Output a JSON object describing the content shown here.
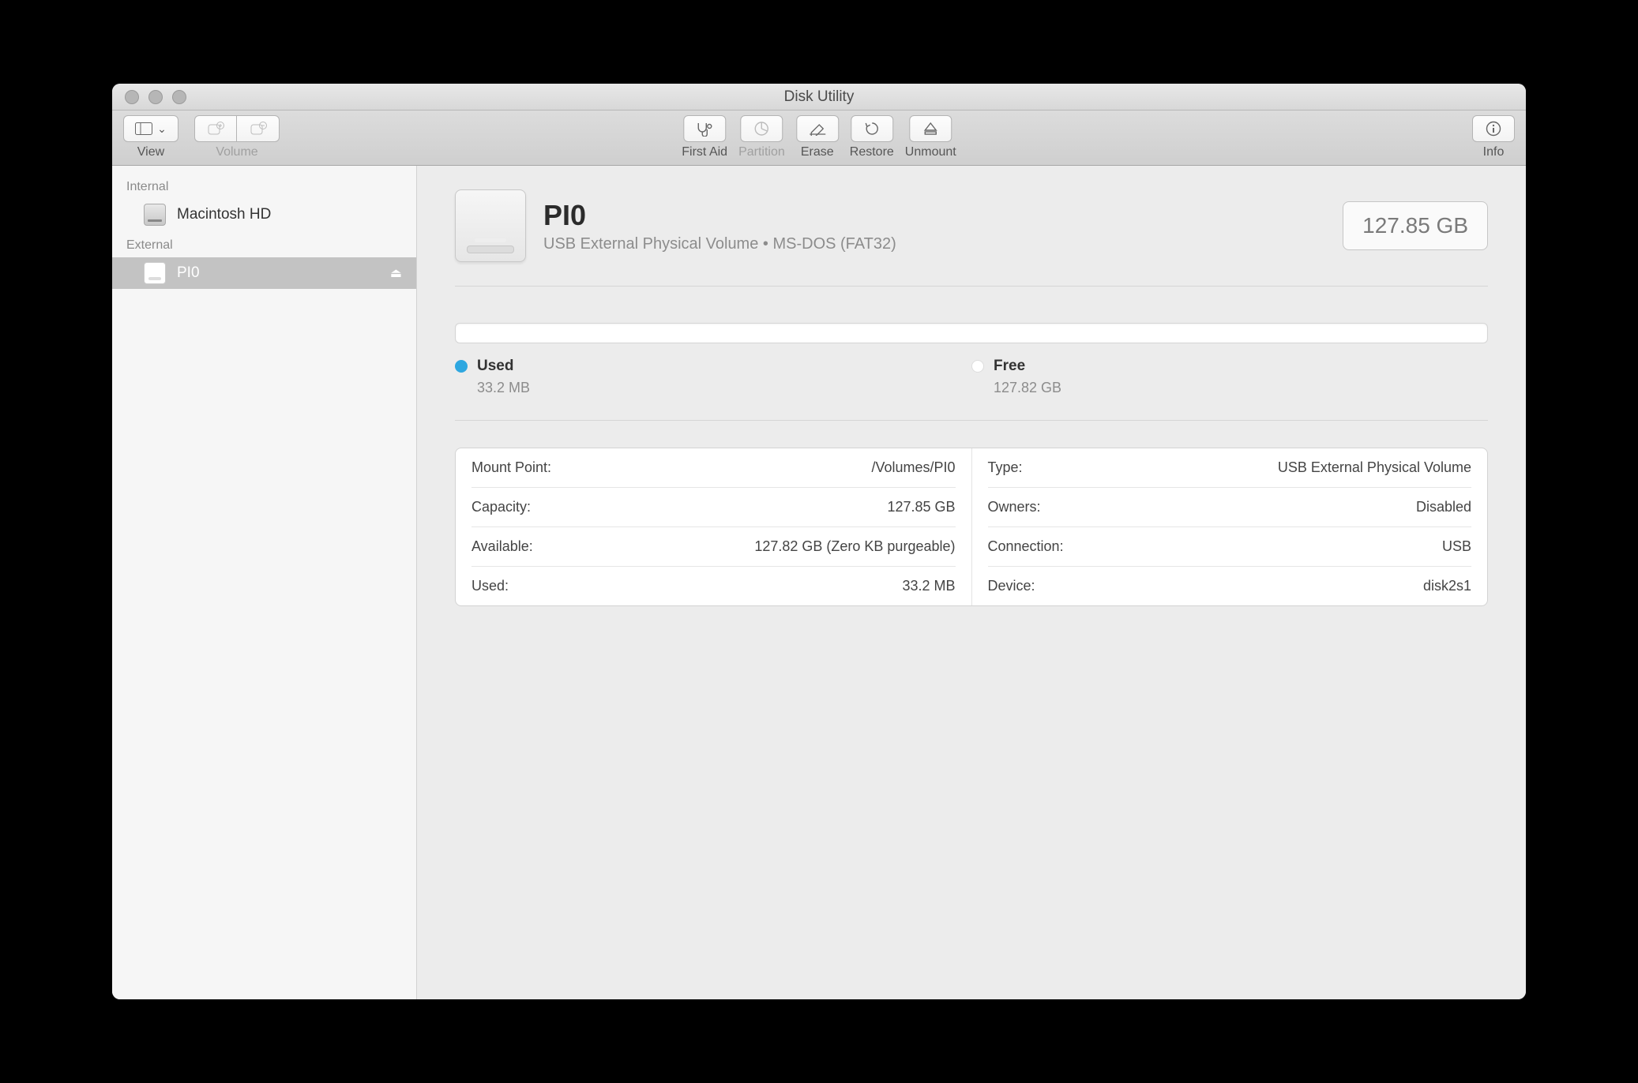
{
  "window": {
    "title": "Disk Utility"
  },
  "toolbar": {
    "view_label": "View",
    "volume_label": "Volume",
    "first_aid_label": "First Aid",
    "partition_label": "Partition",
    "erase_label": "Erase",
    "restore_label": "Restore",
    "unmount_label": "Unmount",
    "info_label": "Info"
  },
  "sidebar": {
    "internal_header": "Internal",
    "external_header": "External",
    "internal_items": [
      {
        "label": "Macintosh HD"
      }
    ],
    "external_items": [
      {
        "label": "PI0"
      }
    ]
  },
  "volume": {
    "name": "PI0",
    "subtitle": "USB External Physical Volume • MS-DOS (FAT32)",
    "capacity_box": "127.85 GB",
    "used_label": "Used",
    "used_value": "33.2 MB",
    "free_label": "Free",
    "free_value": "127.82 GB",
    "details_left": [
      {
        "k": "Mount Point:",
        "v": "/Volumes/PI0"
      },
      {
        "k": "Capacity:",
        "v": "127.85 GB"
      },
      {
        "k": "Available:",
        "v": "127.82 GB (Zero KB purgeable)"
      },
      {
        "k": "Used:",
        "v": "33.2 MB"
      }
    ],
    "details_right": [
      {
        "k": "Type:",
        "v": "USB External Physical Volume"
      },
      {
        "k": "Owners:",
        "v": "Disabled"
      },
      {
        "k": "Connection:",
        "v": "USB"
      },
      {
        "k": "Device:",
        "v": "disk2s1"
      }
    ]
  }
}
